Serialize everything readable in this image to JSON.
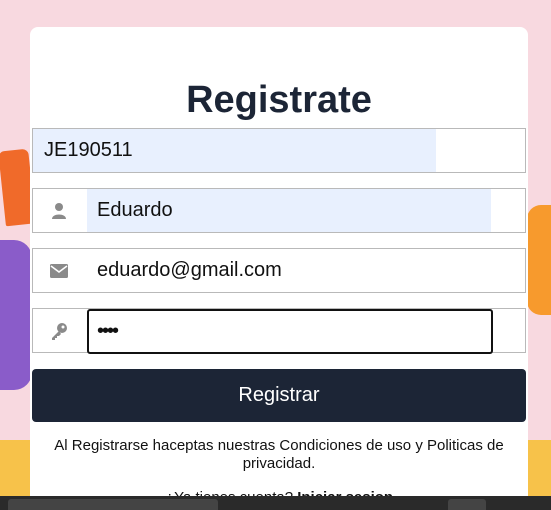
{
  "form": {
    "title": "Registrate",
    "code_value": "JE190511",
    "name_value": "Eduardo",
    "email_value": "eduardo@gmail.com",
    "password_value": "••••",
    "submit_label": "Registrar",
    "terms_text": "Al Registrarse haceptas nuestras Condiciones de uso y Politicas de privacidad.",
    "login_prompt": "¿Ya tienes cuenta?",
    "login_link": "Iniciar sesion"
  },
  "icons": {
    "name": "user-icon",
    "email": "envelope-icon",
    "password": "key-icon"
  },
  "colors": {
    "background": "#f8d9e0",
    "card": "#ffffff",
    "primary": "#1c2536",
    "autofill": "#e8f0fe"
  }
}
